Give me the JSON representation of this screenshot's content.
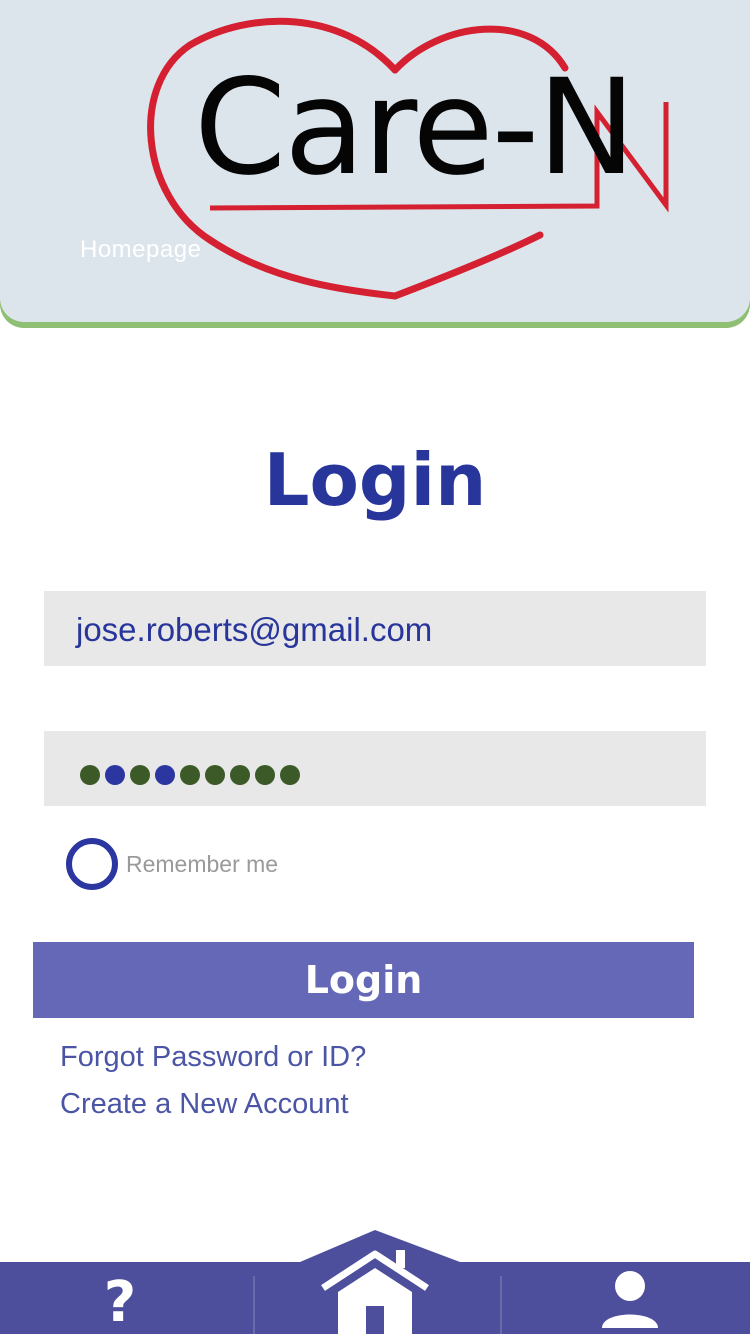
{
  "header": {
    "logo_text": "Care-N",
    "homepage_label": "Homepage"
  },
  "page_title": "Login",
  "form": {
    "email_value": "jose.roberts@gmail.com",
    "password_dot_count": 9,
    "remember_label": "Remember me",
    "remember_checked": false,
    "login_button_label": "Login"
  },
  "links": {
    "forgot": "Forgot Password or ID?",
    "create_account": "Create a New Account"
  },
  "bottom_nav": {
    "items": [
      {
        "name": "help",
        "icon": "question-mark-icon",
        "glyph": "?"
      },
      {
        "name": "home",
        "icon": "house-icon"
      },
      {
        "name": "profile",
        "icon": "user-icon"
      }
    ]
  },
  "colors": {
    "header_bg": "#dde5ec",
    "header_border": "#8fbf73",
    "brand_red": "#d42030",
    "title_blue": "#28359a",
    "button_purple": "#6568b6",
    "link_color": "#4b55a6",
    "nav_bg": "#4d4e9c",
    "field_bg": "#e8e8e8",
    "dot_green": "#3b5a27",
    "dot_blue": "#2c36a0"
  }
}
